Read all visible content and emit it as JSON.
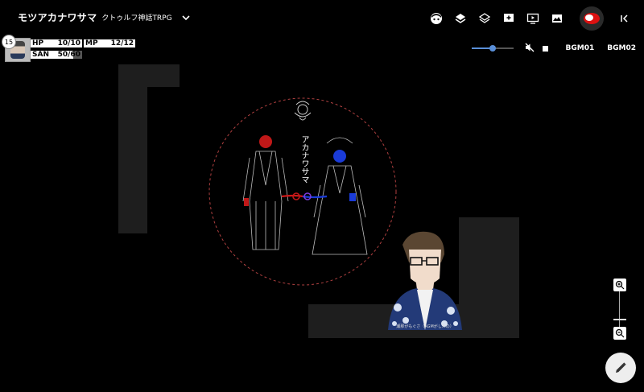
{
  "room": {
    "title": "モツアカナワサマ",
    "system": "クトゥルフ神話TRPG"
  },
  "toolbar": {
    "icons": [
      "character-icon",
      "layers-icon",
      "layers-outline-icon",
      "add-chat-icon",
      "screen-icon",
      "scene-icon",
      "user-avatar-icon",
      "collapse-icon"
    ]
  },
  "character": {
    "initiative": "15",
    "hp_label": "HP",
    "hp_value": "10/10",
    "mp_label": "MP",
    "mp_value": "12/12",
    "san_label": "SAN",
    "san_value": "50/60",
    "san_fraction": 0.833
  },
  "bgm": {
    "volume": 0.5,
    "track1": "BGM01",
    "track2": "BGM02"
  },
  "board": {
    "art_title": "アカナワサマ",
    "standee_caption": "瀬那がもぐさ（AGMがしたの）",
    "colors": {
      "ring": "#b04040",
      "red": "#d01818",
      "blue": "#1a3bd8",
      "wall": "#1e1e1e"
    }
  }
}
